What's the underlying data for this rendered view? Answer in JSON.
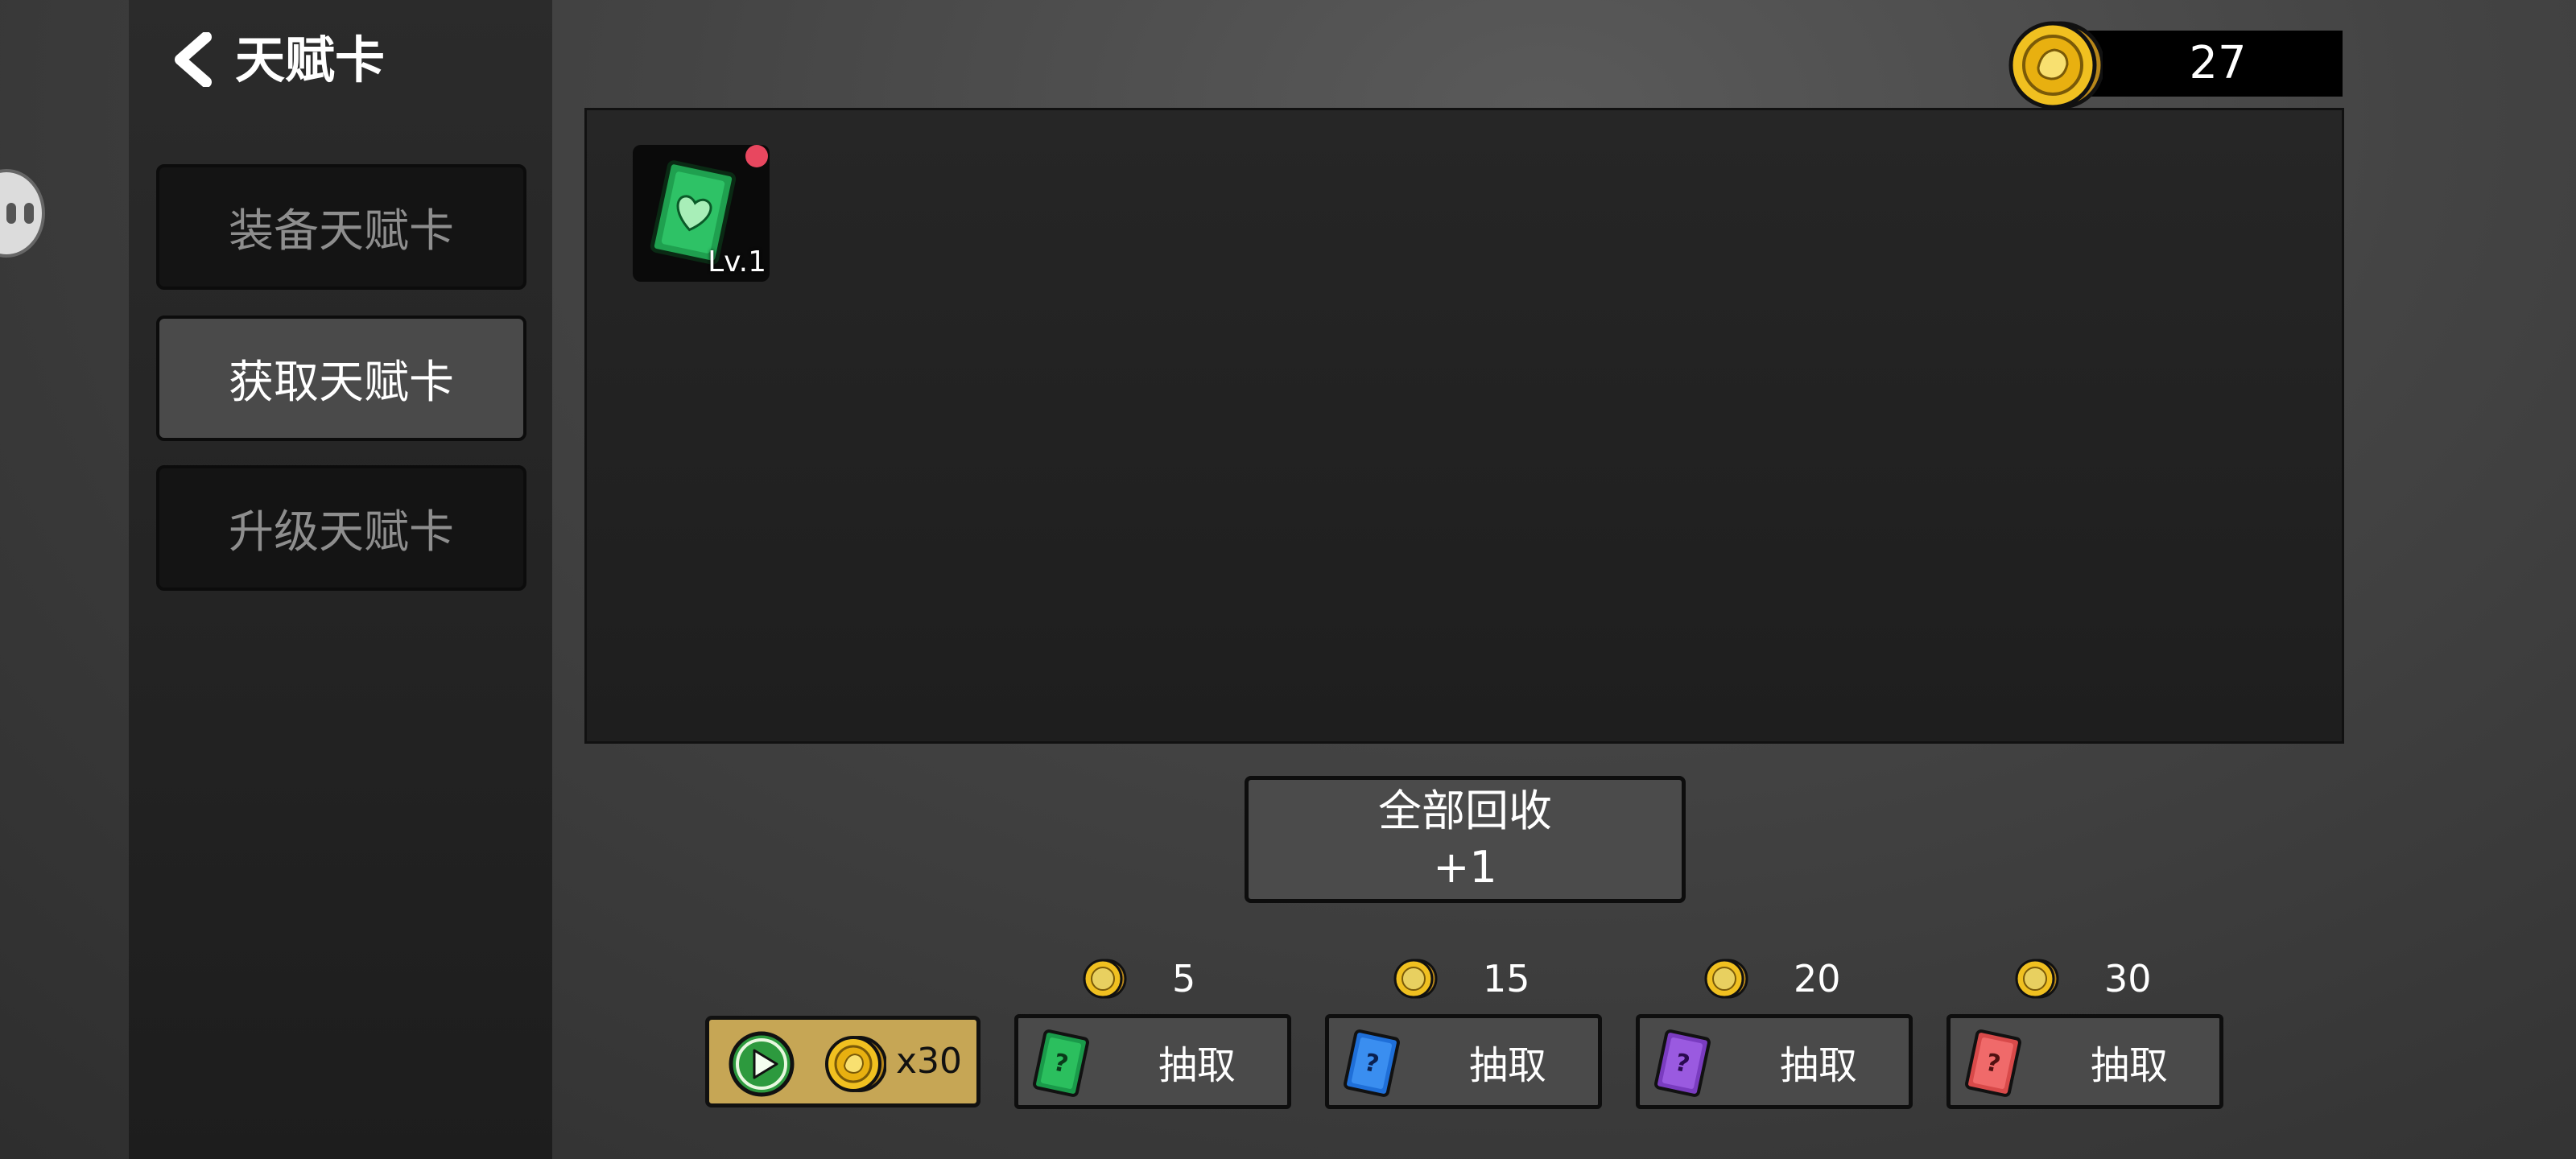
{
  "header": {
    "title": "天赋卡"
  },
  "sidebar": {
    "tabs": [
      {
        "label": "装备天赋卡",
        "active": false
      },
      {
        "label": "获取天赋卡",
        "active": true
      },
      {
        "label": "升级天赋卡",
        "active": false
      }
    ]
  },
  "currency": {
    "icon": "gold-coin-icon",
    "amount": "27"
  },
  "inventory": {
    "cards": [
      {
        "icon": "green-heart-card-icon",
        "level": "Lv.1",
        "new": true,
        "color": "#1fa04f"
      }
    ]
  },
  "recycle": {
    "label": "全部回收",
    "reward": "+1"
  },
  "ad_reward": {
    "icon": "play-icon",
    "amount": "x30"
  },
  "draws": [
    {
      "cost": "5",
      "label": "抽取",
      "card_color": "#1a9a4a",
      "icon": "green-mystery-card-icon"
    },
    {
      "cost": "15",
      "label": "抽取",
      "card_color": "#1f6fd8",
      "icon": "blue-mystery-card-icon"
    },
    {
      "cost": "20",
      "label": "抽取",
      "card_color": "#7a3cc0",
      "icon": "purple-mystery-card-icon"
    },
    {
      "cost": "30",
      "label": "抽取",
      "card_color": "#d84a4a",
      "icon": "red-mystery-card-icon"
    }
  ]
}
